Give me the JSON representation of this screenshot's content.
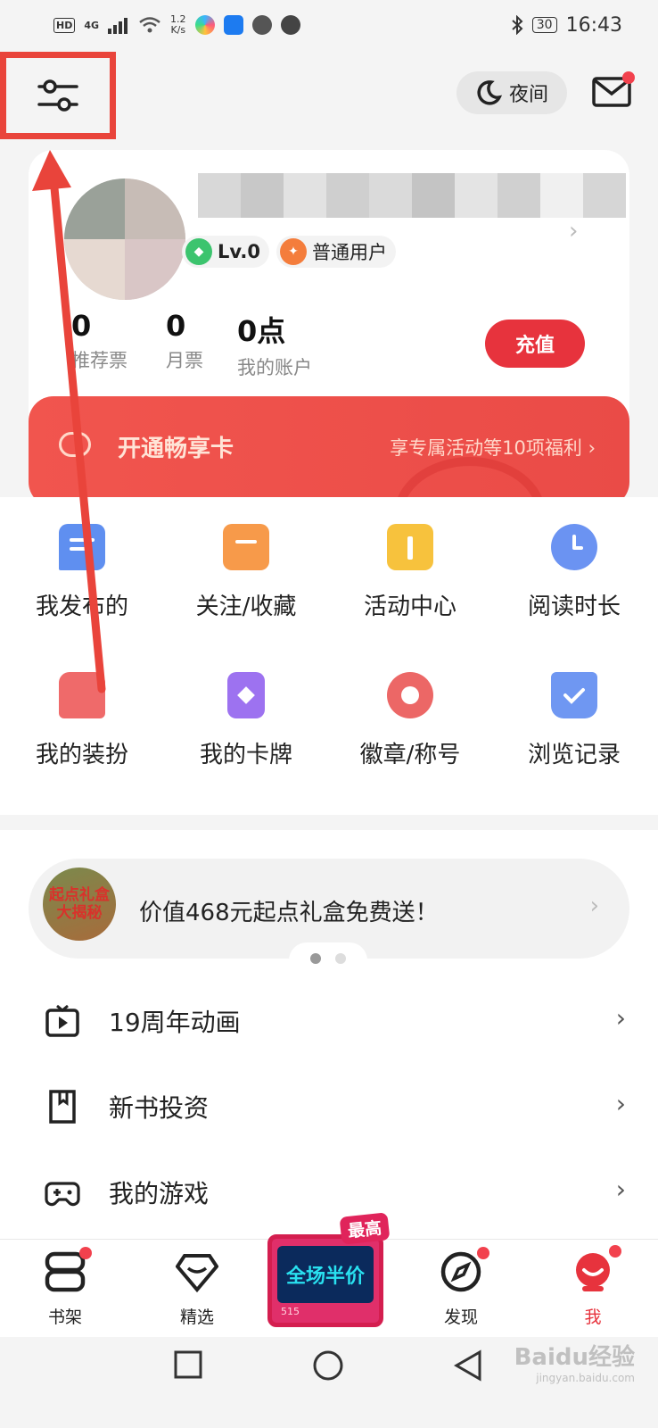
{
  "status_bar": {
    "hd": "HD",
    "network": "4G",
    "speed": "1.2",
    "speed_unit": "K/s",
    "battery": "30",
    "time": "16:43"
  },
  "header": {
    "night_label": "夜间",
    "mail_has_badge": true
  },
  "profile": {
    "level_badge": "Lv.0",
    "user_type_badge": "普通用户",
    "stats": [
      {
        "value": "0",
        "label": "推荐票"
      },
      {
        "value": "0",
        "label": "月票"
      },
      {
        "value": "0点",
        "label": "我的账户"
      }
    ],
    "recharge_label": "充值"
  },
  "vip_banner": {
    "title": "开通畅享卡",
    "description": "享专属活动等10项福利"
  },
  "grid": [
    {
      "label": "我发布的",
      "icon": "chat-bubble-icon",
      "color": "#5f8ff0"
    },
    {
      "label": "关注/收藏",
      "icon": "folder-icon",
      "color": "#f79a4a"
    },
    {
      "label": "活动中心",
      "icon": "gift-icon",
      "color": "#f7c23d"
    },
    {
      "label": "阅读时长",
      "icon": "clock-icon",
      "color": "#6b93f2"
    },
    {
      "label": "我的装扮",
      "icon": "tshirt-icon",
      "color": "#ef6a6a"
    },
    {
      "label": "我的卡牌",
      "icon": "card-icon",
      "color": "#9d72f0"
    },
    {
      "label": "徽章/称号",
      "icon": "medal-icon",
      "color": "#ec6766"
    },
    {
      "label": "浏览记录",
      "icon": "bookmark-check-icon",
      "color": "#6f97f2"
    }
  ],
  "promo": {
    "thumb_text": "起点礼盒 大揭秘",
    "text": "价值468元起点礼盒免费送！"
  },
  "list": [
    {
      "label": "19周年动画",
      "icon": "tv-play-icon"
    },
    {
      "label": "新书投资",
      "icon": "bookmark-icon"
    },
    {
      "label": "我的游戏",
      "icon": "gamepad-icon"
    }
  ],
  "bottom_nav": {
    "items": [
      {
        "label": "书架",
        "badge": true
      },
      {
        "label": "精选",
        "badge": false
      },
      {
        "label": "发现",
        "badge": true
      },
      {
        "label": "我",
        "badge": true,
        "active": true
      }
    ],
    "center_promo": {
      "tag": "最高",
      "screen_text": "全场半价",
      "number": "515"
    }
  },
  "colors": {
    "accent_red": "#e7333d",
    "annotation_red": "#e9443b"
  },
  "watermark": {
    "brand": "Baidu经验",
    "domain": "jingyan.baidu.com"
  }
}
